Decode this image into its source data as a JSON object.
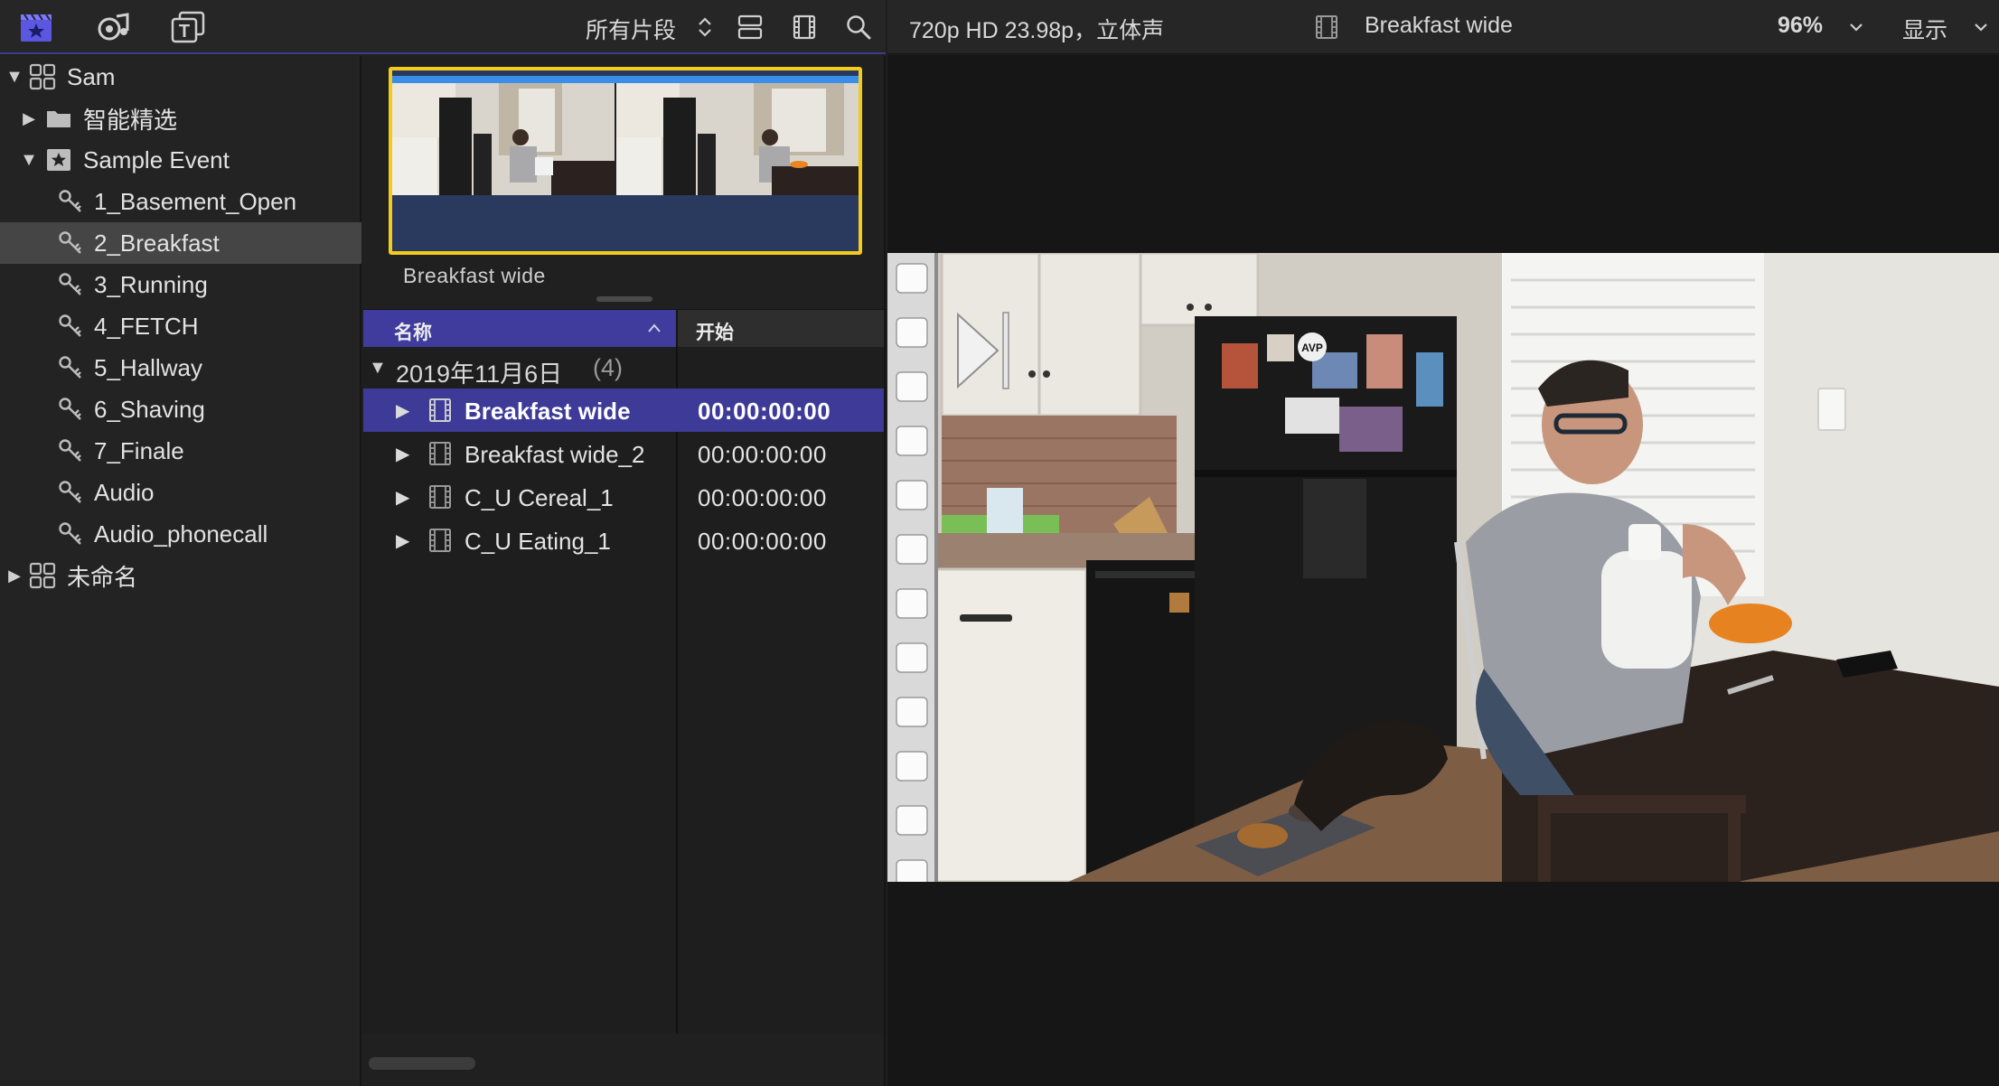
{
  "toolbar": {
    "filter_label": "所有片段",
    "format_info": "720p HD 23.98p，立体声",
    "clip_title": "Breakfast wide",
    "zoom": "96%",
    "view_label": "显示"
  },
  "sidebar": {
    "items": [
      {
        "label": "Sam"
      },
      {
        "label": "智能精选"
      },
      {
        "label": "Sample Event"
      },
      {
        "label": "1_Basement_Open"
      },
      {
        "label": "2_Breakfast"
      },
      {
        "label": "3_Running"
      },
      {
        "label": "4_FETCH"
      },
      {
        "label": "5_Hallway"
      },
      {
        "label": "6_Shaving"
      },
      {
        "label": "7_Finale"
      },
      {
        "label": "Audio"
      },
      {
        "label": "Audio_phonecall"
      },
      {
        "label": "未命名"
      }
    ]
  },
  "browser": {
    "filmstrip_title": "Breakfast wide",
    "columns": {
      "name": "名称",
      "start": "开始"
    },
    "group": {
      "date": "2019年11月6日",
      "count": "(4)"
    },
    "clips": [
      {
        "name": "Breakfast wide",
        "start": "00:00:00:00"
      },
      {
        "name": "Breakfast wide_2",
        "start": "00:00:00:00"
      },
      {
        "name": "C_U Cereal_1",
        "start": "00:00:00:00"
      },
      {
        "name": "C_U Eating_1",
        "start": "00:00:00:00"
      }
    ]
  },
  "colors": {
    "accent": "#3d3a98",
    "selection_yellow": "#f2cb1d",
    "sidebar_selected": "#454545"
  }
}
